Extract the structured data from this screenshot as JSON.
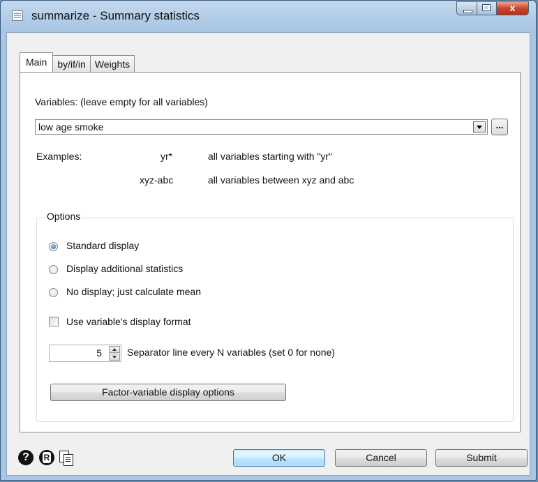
{
  "window": {
    "title": "summarize - Summary statistics",
    "close_glyph": "x"
  },
  "tabs": [
    {
      "label": "Main",
      "active": true
    },
    {
      "label": "by/if/in",
      "active": false
    },
    {
      "label": "Weights",
      "active": false
    }
  ],
  "variables": {
    "label": "Variables: (leave empty for all variables)",
    "value": "low age smoke",
    "browse_label": "..."
  },
  "examples": {
    "label": "Examples:",
    "rows": [
      {
        "pattern": "yr*",
        "description": "all variables starting with \"yr\""
      },
      {
        "pattern": "xyz-abc",
        "description": "all variables between xyz and abc"
      }
    ]
  },
  "options": {
    "title": "Options",
    "radios": [
      {
        "label": "Standard display",
        "checked": true
      },
      {
        "label": "Display additional statistics",
        "checked": false
      },
      {
        "label": "No display; just calculate mean",
        "checked": false
      }
    ],
    "format_checkbox": {
      "label": "Use variable's display format",
      "checked": false
    },
    "separator": {
      "value": "5",
      "label": "Separator line every N variables (set 0 for none)"
    },
    "factor_button": "Factor-variable display options"
  },
  "footer": {
    "help_glyph": "?",
    "ok": "OK",
    "cancel": "Cancel",
    "submit": "Submit"
  },
  "icons": [
    "app-icon",
    "minimize-icon",
    "maximize-icon",
    "close-icon",
    "dropdown-arrow-icon",
    "spin-up-icon",
    "spin-down-icon",
    "help-icon",
    "reset-icon",
    "copy-icon"
  ],
  "colors": {
    "title_bar": "#a9c6e4",
    "close_button": "#c7462b",
    "default_button": "#3c7fb1"
  }
}
